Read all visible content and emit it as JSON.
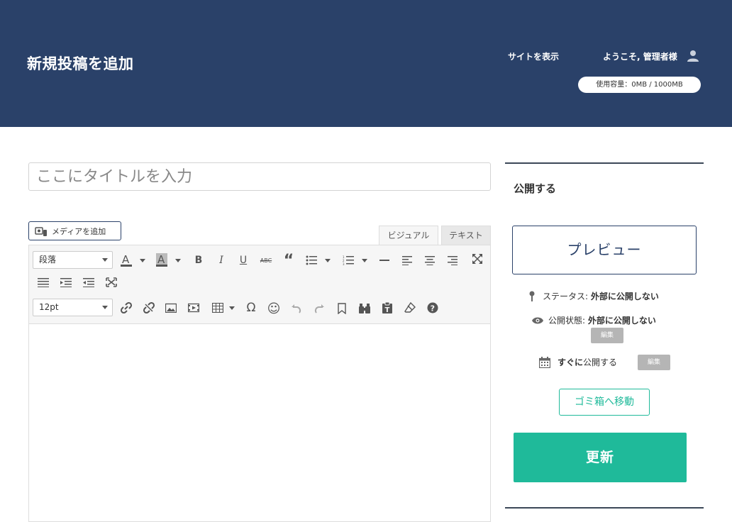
{
  "header": {
    "title": "新規投稿を追加",
    "site_link": "サイトを表示",
    "welcome": "ようこそ, 管理者様",
    "usage": "使用容量：0MB / 1000MB",
    "bg_color": "#2a4169"
  },
  "editor": {
    "title_placeholder": "ここにタイトルを入力",
    "media_button": "メディアを追加",
    "tabs": [
      "ビジュアル",
      "テキスト"
    ],
    "format_select": "段落",
    "font_size_select": "12pt"
  },
  "publish": {
    "heading": "公開する",
    "preview_button": "プレビュー",
    "status_label": "ステータス: ",
    "status_value": "外部に公開しない",
    "visibility_label": "公開状態: ",
    "visibility_value": "外部に公開しない",
    "edit_label": "編集",
    "schedule_bold": "すぐに",
    "schedule_text": "公開する",
    "trash_button": "ゴミ箱へ移動",
    "update_button": "更新",
    "accent_color": "#1fba9a"
  }
}
